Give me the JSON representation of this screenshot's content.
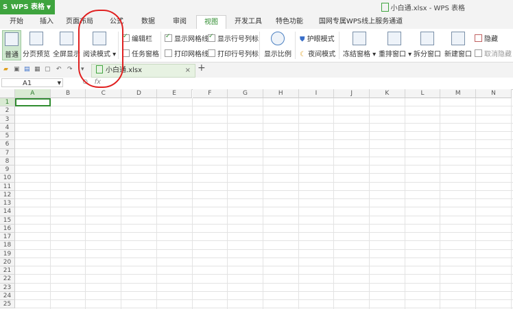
{
  "app": {
    "name": "WPS 表格",
    "logo_letter": "S"
  },
  "window": {
    "title": "小白通.xlsx - WPS 表格"
  },
  "tabs": [
    "开始",
    "插入",
    "页面布局",
    "公式",
    "数据",
    "审阅",
    "视图",
    "开发工具",
    "特色功能",
    "国网专属WPS线上服务通道"
  ],
  "active_tab": "视图",
  "ribbon": {
    "normal": "普通",
    "page_break": "分页预览",
    "full_screen": "全屏显示",
    "reading_mode": "阅读模式",
    "edit_bar": "编辑栏",
    "task_pane": "任务窗格",
    "show_gridlines": "显示网格线",
    "show_headers": "显示行号列标",
    "print_gridlines": "打印网格线",
    "print_headers": "打印行号列标",
    "zoom": "显示比例",
    "eye_protection": "护眼模式",
    "night_mode": "夜间模式",
    "freeze": "冻结窗格",
    "rearrange": "重排窗口",
    "split": "拆分窗口",
    "new_window": "新建窗口",
    "hide": "隐藏",
    "unhide": "取消隐藏"
  },
  "document_tab": {
    "name": "小白通.xlsx",
    "close": "×",
    "new": "+"
  },
  "formula_bar": {
    "cell_ref": "A1",
    "fx": "fx"
  },
  "columns": [
    "A",
    "B",
    "C",
    "D",
    "E",
    "F",
    "G",
    "H",
    "I",
    "J",
    "K",
    "L",
    "M",
    "N"
  ],
  "rows": [
    "1",
    "2",
    "3",
    "4",
    "5",
    "6",
    "7",
    "8",
    "9",
    "10",
    "11",
    "12",
    "13",
    "14",
    "15",
    "16",
    "17",
    "18",
    "19",
    "20",
    "21",
    "22",
    "23",
    "24",
    "25"
  ],
  "colors": {
    "accent": "#3ea43e",
    "annotation": "#e02020"
  }
}
